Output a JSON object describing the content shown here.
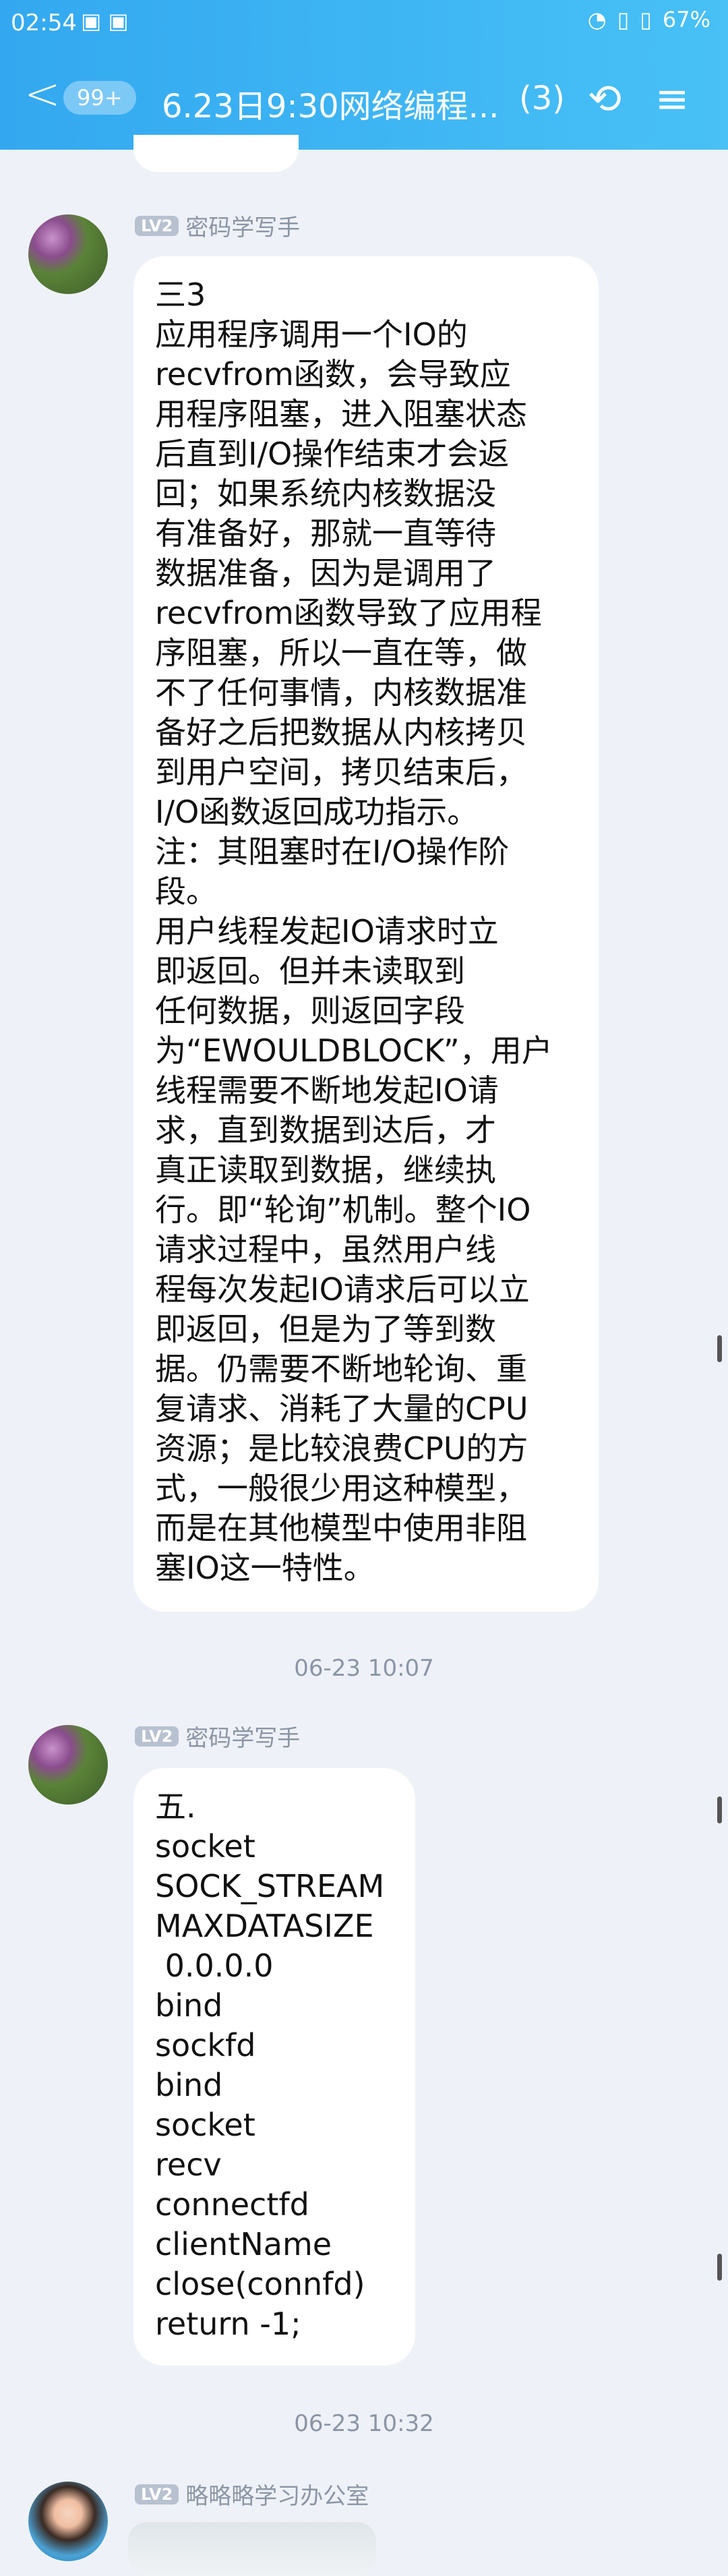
{
  "status": {
    "time": "02:54",
    "battery": "67%"
  },
  "header": {
    "unread": "99+",
    "title": "6.23日9:30网络编程...",
    "member_count": "(3)"
  },
  "messages": [
    {
      "sender": "密码学写手",
      "level": "LV2",
      "lines": [
        "三3",
        "应用程序调用一个IO的",
        "recvfrom函数，会导致应",
        "用程序阻塞，进入阻塞状态",
        "后直到I/O操作结束才会返",
        "回；如果系统内核数据没",
        "有准备好，那就一直等待",
        "数据准备，因为是调用了",
        "recvfrom函数导致了应用程",
        "序阻塞，所以一直在等，做",
        "不了任何事情，内核数据准",
        "备好之后把数据从内核拷贝",
        "到用户空间，拷贝结束后，",
        "I/O函数返回成功指示。",
        "注：其阻塞时在I/O操作阶",
        "段。",
        "用户线程发起IO请求时立",
        "即返回。但并未读取到",
        "任何数据，则返回字段",
        "为“EWOULDBLOCK”，用户",
        "线程需要不断地发起IO请",
        "求，直到数据到达后，才",
        "真正读取到数据，继续执",
        "行。即“轮询”机制。整个IO",
        "请求过程中，虽然用户线",
        "程每次发起IO请求后可以立",
        "即返回，但是为了等到数",
        "据。仍需要不断地轮询、重",
        "复请求、消耗了大量的CPU",
        "资源；是比较浪费CPU的方",
        "式，一般很少用这种模型，",
        "而是在其他模型中使用非阻",
        "塞IO这一特性。"
      ]
    },
    {
      "sender": "密码学写手",
      "level": "LV2",
      "lines": [
        "五.",
        "socket",
        "SOCK_STREAM",
        "MAXDATASIZE",
        " 0.0.0.0",
        "bind",
        "sockfd",
        "bind",
        "socket",
        "recv",
        "connectfd",
        "clientName",
        "close(connfd)",
        "return -1;"
      ]
    },
    {
      "sender": "略略略学习办公室",
      "level": "LV2",
      "lines": []
    }
  ],
  "timestamps": [
    "06-23 10:07",
    "06-23 10:32"
  ]
}
